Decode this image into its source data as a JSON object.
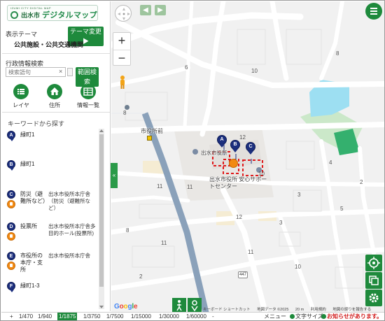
{
  "logo": {
    "tiny": "IZUMI CITY DIGITAL MAP",
    "city": "出水市",
    "title": "デジタルマップ"
  },
  "theme": {
    "label": "表示テーマ",
    "change_button": "テーマ変更 ▶",
    "current": "公共施設・公共交通機関"
  },
  "search": {
    "label": "行政情報検索",
    "placeholder": "検索語句",
    "clear": "×",
    "range_button": "範囲検索"
  },
  "tools": [
    {
      "label": "レイヤ",
      "icon": "list-icon"
    },
    {
      "label": "住所",
      "icon": "home-icon"
    },
    {
      "label": "情報一覧",
      "icon": "table-icon"
    }
  ],
  "keywords": {
    "title": "キーワードから探す",
    "items": [
      {
        "pin": "A",
        "name": "緑町1",
        "place": "",
        "has_facility_icon": false
      },
      {
        "pin": "B",
        "name": "緑町1",
        "place": "",
        "has_facility_icon": false
      },
      {
        "pin": "C",
        "name": "防災（避難所など）",
        "place": "出水市役所本庁舎（防災（避難所など）",
        "has_facility_icon": true
      },
      {
        "pin": "D",
        "name": "投票所",
        "place": "出水市役所本庁舎多目的ホール(投票所)",
        "has_facility_icon": true
      },
      {
        "pin": "E",
        "name": "市役所の本庁・支所",
        "place": "出水市役所本庁舎",
        "has_facility_icon": true
      },
      {
        "pin": "F",
        "name": "緑町1-3",
        "place": "",
        "has_facility_icon": false
      }
    ]
  },
  "map": {
    "labels": {
      "station": "市役所前",
      "city_hall": "出水市役所",
      "support_center": "出水市役所 安心サポートセンター"
    },
    "block_numbers": [
      "6",
      "10",
      "8",
      "8",
      "12",
      "11",
      "11",
      "10",
      "3",
      "4",
      "5",
      "2",
      "12",
      "3",
      "8",
      "11",
      "11",
      "10",
      "2"
    ],
    "route_number": "447",
    "map_pins": [
      "A",
      "B",
      "C"
    ],
    "google": "Google",
    "attribution": [
      "キーボード ショートカット",
      "地図データ ©2025",
      "20 m",
      "利用規約",
      "地図の誤りを報告する"
    ]
  },
  "scale": {
    "plus": "+",
    "values": [
      "1/470",
      "1/940",
      "1/1875",
      "1/3750",
      "1/7500",
      "1/15000",
      "1/30000",
      "1/60000"
    ],
    "active": "1/1875",
    "minus": "-"
  },
  "footer": {
    "menu": "メニュー",
    "text_size": "文字サイズ",
    "notice": "お知らせがあります。"
  },
  "colors": {
    "brand_green": "#1e8a3c",
    "pin_navy": "#1c2f7e",
    "highlight_red": "#e0191b",
    "facility_orange": "#f28a12",
    "water_blue": "#9ddff2"
  }
}
